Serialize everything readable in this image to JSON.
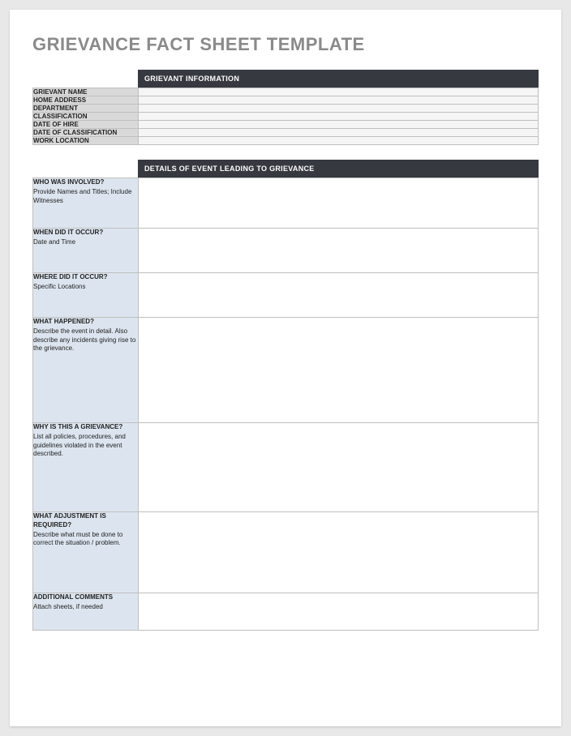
{
  "title": "GRIEVANCE FACT SHEET TEMPLATE",
  "section1": {
    "header": "GRIEVANT INFORMATION"
  },
  "info": {
    "rows": [
      {
        "label": "GRIEVANT NAME",
        "value": ""
      },
      {
        "label": "HOME ADDRESS",
        "value": ""
      },
      {
        "label": "DEPARTMENT",
        "value": ""
      },
      {
        "label": "CLASSIFICATION",
        "value": ""
      },
      {
        "label": "DATE OF HIRE",
        "value": ""
      },
      {
        "label": "DATE OF CLASSIFICATION",
        "value": ""
      },
      {
        "label": "WORK LOCATION",
        "value": ""
      }
    ]
  },
  "section2": {
    "header": "DETAILS OF EVENT LEADING TO GRIEVANCE"
  },
  "details": {
    "who": {
      "q": "WHO WAS INVOLVED?",
      "desc": "Provide Names and Titles; Include Witnesses",
      "value": ""
    },
    "when": {
      "q": "WHEN DID IT OCCUR?",
      "desc": "Date and Time",
      "value": ""
    },
    "where": {
      "q": "WHERE DID IT OCCUR?",
      "desc": "Specific Locations",
      "value": ""
    },
    "what": {
      "q": "WHAT HAPPENED?",
      "desc": "Describe the event in detail.  Also describe any incidents giving rise to the grievance.",
      "value": ""
    },
    "why": {
      "q": "WHY IS THIS A GRIEVANCE?",
      "desc": "List all policies, procedures, and guidelines violated in the event described.",
      "value": ""
    },
    "adj": {
      "q": "WHAT ADJUSTMENT IS REQUIRED?",
      "desc": "Describe what must be done to correct the situation / problem.",
      "value": ""
    },
    "add": {
      "q": "ADDITIONAL COMMENTS",
      "desc": "Attach sheets, if needed",
      "value": ""
    }
  }
}
